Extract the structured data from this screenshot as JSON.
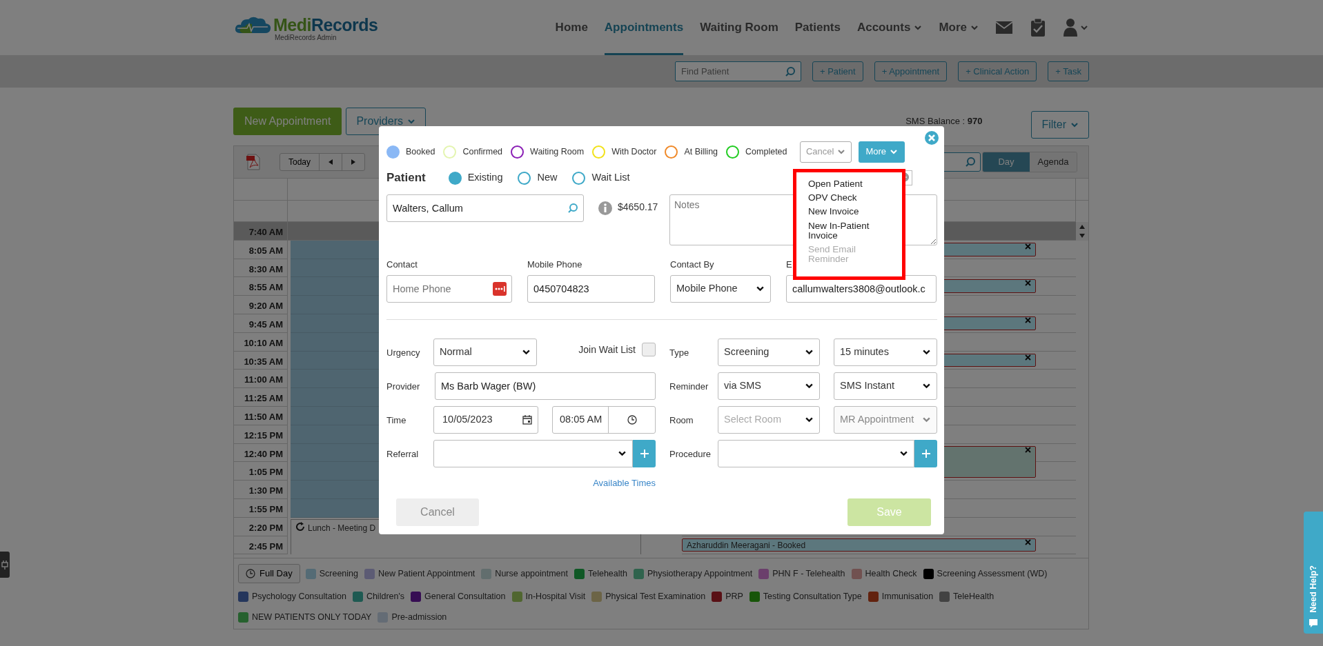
{
  "brand": {
    "name_parts": [
      "Medi",
      "Records"
    ],
    "subtitle": "MediRecords Admin"
  },
  "nav": [
    {
      "label": "Home",
      "selected": false,
      "dropdown": false
    },
    {
      "label": "Appointments",
      "selected": true,
      "dropdown": false
    },
    {
      "label": "Waiting Room",
      "selected": false,
      "dropdown": false
    },
    {
      "label": "Patients",
      "selected": false,
      "dropdown": false
    },
    {
      "label": "Accounts",
      "selected": false,
      "dropdown": true
    },
    {
      "label": "More",
      "selected": false,
      "dropdown": true
    }
  ],
  "toolbar": {
    "search_placeholder": "Find Patient",
    "buttons": [
      "+ Patient",
      "+ Appointment",
      "+ Clinical Action",
      "+ Task"
    ]
  },
  "actions": {
    "new_appointment": "New Appointment",
    "providers": "Providers",
    "sms_balance_label": "SMS Balance :",
    "sms_balance": "970",
    "filter": "Filter"
  },
  "calendar": {
    "today": "Today",
    "views": [
      {
        "label": "Day",
        "selected": true
      },
      {
        "label": "Agenda",
        "selected": false
      }
    ],
    "rows": [
      {
        "time": "7:40 AM",
        "kind": "past",
        "booked": false
      },
      {
        "time": "8:05 AM",
        "kind": "session",
        "booked": true
      },
      {
        "time": "8:30 AM",
        "kind": "session",
        "booked": false
      },
      {
        "time": "8:55 AM",
        "kind": "session",
        "booked": true
      },
      {
        "time": "9:20 AM",
        "kind": "session",
        "booked": false
      },
      {
        "time": "9:45 AM",
        "kind": "session",
        "booked": true
      },
      {
        "time": "10:10 AM",
        "kind": "session",
        "booked": false
      },
      {
        "time": "10:35 AM",
        "kind": "session",
        "booked": true
      },
      {
        "time": "11:00 AM",
        "kind": "session",
        "booked": false
      },
      {
        "time": "11:25 AM",
        "kind": "session",
        "booked": false
      },
      {
        "time": "11:50 AM",
        "kind": "session",
        "booked": false
      },
      {
        "time": "12:15 PM",
        "kind": "session",
        "booked": false
      },
      {
        "time": "12:40 PM",
        "kind": "session",
        "booked": true
      },
      {
        "time": "1:05 PM",
        "kind": "session",
        "booked": true
      },
      {
        "time": "1:30 PM",
        "kind": "session",
        "booked": false
      },
      {
        "time": "1:55 PM",
        "kind": "session",
        "booked": false
      },
      {
        "time": "2:20 PM",
        "kind": "lunch",
        "booked": false,
        "lunch_text": "Lunch - Meeting D"
      },
      {
        "time": "2:45 PM",
        "kind": "lunch",
        "booked": true,
        "booking_text": "Azharuddin Meeragani - Booked"
      }
    ],
    "full_day": "Full Day"
  },
  "legend": [
    {
      "label": "Screening",
      "color": "#546b75"
    },
    {
      "label": "New Patient Appointment",
      "color": "#5c5b74"
    },
    {
      "label": "Nurse appointment",
      "color": "#626e6e"
    },
    {
      "label": "Telehealth",
      "color": "#0f5825"
    },
    {
      "label": "Physiotherapy Appointment",
      "color": "#2f634d"
    },
    {
      "label": "PHN F - Telehealth",
      "color": "#6b3f6c"
    },
    {
      "label": "Health Check",
      "color": "#715150"
    },
    {
      "label": "Screening Assessment (WD)",
      "color": "#000000"
    },
    {
      "label": "Psychology Consultation",
      "color": "#25365c"
    },
    {
      "label": "Children's",
      "color": "#1e5a52"
    },
    {
      "label": "General Consultation",
      "color": "#360d53"
    },
    {
      "label": "In-Hospital Visit",
      "color": "#506630"
    },
    {
      "label": "Physical Test Examination",
      "color": "#6c6446"
    },
    {
      "label": "PRP",
      "color": "#591015"
    },
    {
      "label": "Testing Consultation Type",
      "color": "#175509"
    },
    {
      "label": "Immunisation",
      "color": "#62220e"
    },
    {
      "label": "TeleHealth",
      "color": "#424242"
    },
    {
      "label": "NEW PATIENTS ONLY TODAY",
      "color": "#26612e"
    },
    {
      "label": "Pre-admission",
      "color": "#646c75"
    }
  ],
  "modal": {
    "statuses": [
      {
        "label": "Booked",
        "color": "#8ab8f5",
        "selected": true
      },
      {
        "label": "Confirmed",
        "color": "#e4f5b0",
        "selected": false
      },
      {
        "label": "Waiting Room",
        "color": "#8a1fb5",
        "selected": false
      },
      {
        "label": "With Doctor",
        "color": "#f2e21a",
        "selected": false
      },
      {
        "label": "At Billing",
        "color": "#f08a2a",
        "selected": false
      },
      {
        "label": "Completed",
        "color": "#22cc22",
        "selected": false
      }
    ],
    "cancel_menu": "Cancel",
    "more_menu": "More",
    "more_items": [
      {
        "label": "Open Patient",
        "disabled": false
      },
      {
        "label": "OPV Check",
        "disabled": false
      },
      {
        "label": "New Invoice",
        "disabled": false
      },
      {
        "label": "New In-Patient Invoice",
        "disabled": false
      },
      {
        "label": "Send Email Reminder",
        "disabled": true
      }
    ],
    "menu_highlighted": true,
    "patient_label": "Patient",
    "patient_types": [
      {
        "label": "Existing",
        "selected": true
      },
      {
        "label": "New",
        "selected": false
      },
      {
        "label": "Wait List",
        "selected": false
      }
    ],
    "patient": "Walters, Callum",
    "balance": "$4650.17",
    "notes_placeholder": "Notes",
    "contact": [
      {
        "label": "Contact",
        "kind": "phone",
        "placeholder": "Home Phone"
      },
      {
        "label": "Mobile Phone",
        "kind": "input",
        "value": "0450704823"
      },
      {
        "label": "Contact By",
        "kind": "select",
        "value": "Mobile Phone"
      },
      {
        "label": "E",
        "kind": "input",
        "value": "callumwalters3808@outlook.c"
      }
    ],
    "urgency": {
      "label": "Urgency",
      "value": "Normal"
    },
    "join_wait_list": {
      "label": "Join Wait List",
      "checked": false
    },
    "provider": {
      "label": "Provider",
      "value": "Ms Barb Wager (BW)"
    },
    "time": {
      "label": "Time",
      "date": "10/05/2023",
      "time": "08:05 AM"
    },
    "referral": {
      "label": "Referral"
    },
    "available_times": "Available Times",
    "type": {
      "label": "Type",
      "value": "Screening",
      "duration": "15 minutes"
    },
    "reminder": {
      "label": "Reminder",
      "value": "via SMS",
      "timing": "SMS Instant"
    },
    "room": {
      "label": "Room",
      "placeholder": "Select Room",
      "template": "MR Appointment",
      "template_disabled": true
    },
    "procedure": {
      "label": "Procedure"
    },
    "cancel": "Cancel",
    "save": "Save",
    "save_disabled": true
  },
  "help_tab": "Need Help?"
}
